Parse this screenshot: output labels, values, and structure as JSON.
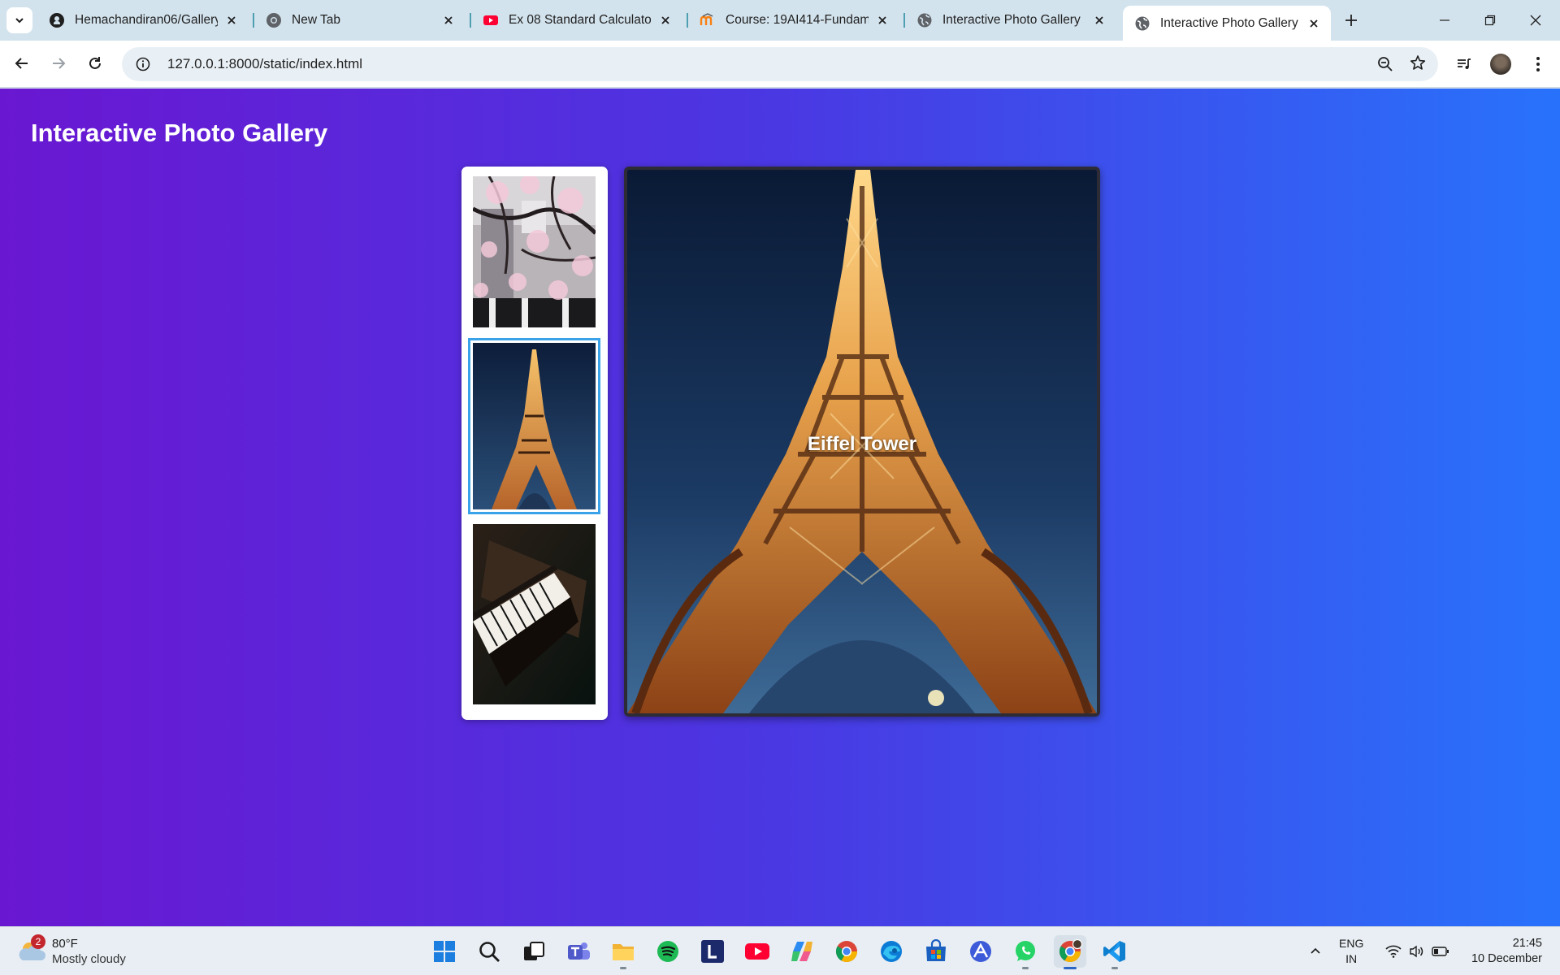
{
  "browser": {
    "tabs": [
      {
        "title": "Hemachandiran06/Gallery",
        "icon": "github-icon"
      },
      {
        "title": "New Tab",
        "icon": "chrome-icon"
      },
      {
        "title": "Ex 08 Standard Calculator |",
        "icon": "youtube-icon"
      },
      {
        "title": "Course: 19AI414-Fundame",
        "icon": "moodle-icon"
      },
      {
        "title": "Interactive Photo Gallery",
        "icon": "globe-icon"
      },
      {
        "title": "Interactive Photo Gallery",
        "icon": "globe-icon",
        "active": true
      }
    ],
    "url": "127.0.0.1:8000/static/index.html"
  },
  "page": {
    "title": "Interactive Photo Gallery",
    "thumbnails": [
      {
        "subject": "cherry blossom building",
        "selected": false
      },
      {
        "subject": "eiffel tower",
        "selected": true
      },
      {
        "subject": "piano",
        "selected": false
      }
    ],
    "main_caption": "Eiffel Tower"
  },
  "taskbar": {
    "weather": {
      "temp": "80°F",
      "desc": "Mostly cloudy",
      "badge": "2"
    },
    "apps": [
      "windows-start-icon",
      "search-icon",
      "task-view-icon",
      "teams-icon",
      "file-explorer-icon",
      "spotify-icon",
      "l-app-icon",
      "youtube-icon",
      "copilot-icon",
      "chrome-icon",
      "edge-icon",
      "store-icon",
      "affinity-icon",
      "whatsapp-icon",
      "chrome-profile-icon",
      "vscode-icon"
    ],
    "lang_1": "ENG",
    "lang_2": "IN",
    "time": "21:45",
    "date": "10 December"
  },
  "colors": {
    "page_gradient_start": "#6a17d1",
    "page_gradient_end": "#2872fb",
    "selected_outline": "#3aa2e8"
  }
}
